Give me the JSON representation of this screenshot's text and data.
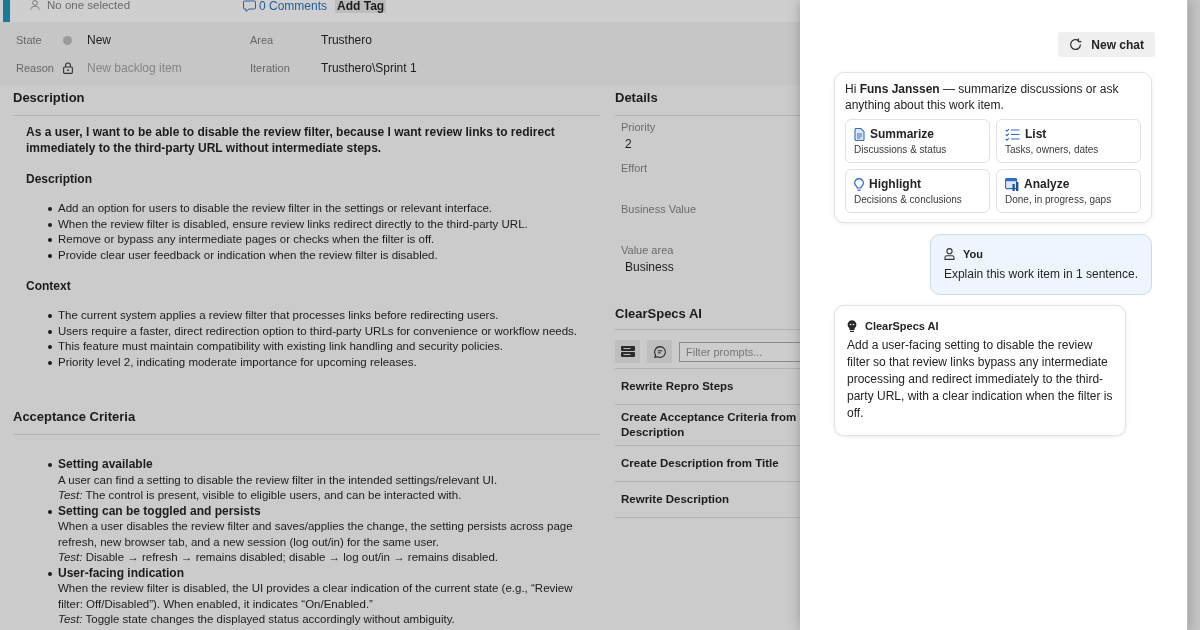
{
  "work_item_header": {
    "assignee": "No one selected",
    "comments_link": "0 Comments",
    "add_tag_button": "Add Tag"
  },
  "fields": [
    {
      "kind": "state",
      "label": "State",
      "value": "New",
      "color": "#9b9b9b"
    },
    {
      "kind": "text",
      "label": "Area",
      "value": "Trusthero"
    },
    {
      "kind": "locked",
      "label": "Reason",
      "value": "New backlog item"
    },
    {
      "kind": "text",
      "label": "Iteration",
      "value": "Trusthero\\Sprint 1"
    }
  ],
  "description": {
    "heading": "Description",
    "summary": "As a user, I want to be able to disable the review filter, because I want review links to redirect immediately to the third-party URL without intermediate steps.",
    "sections": [
      {
        "heading": "Description",
        "bullets": [
          "Add an option for users to disable the review filter in the settings or relevant interface.",
          "When the review filter is disabled, ensure review links redirect directly to the third-party URL.",
          "Remove or bypass any intermediate pages or checks when the filter is off.",
          "Provide clear user feedback or indication when the review filter is disabled."
        ]
      },
      {
        "heading": "Context",
        "bullets": [
          "The current system applies a review filter that processes links before redirecting users.",
          "Users require a faster, direct redirection option to third-party URLs for convenience or workflow needs.",
          "This feature must maintain compatibility with existing link handling and security policies.",
          "Priority level 2, indicating moderate importance for upcoming releases."
        ]
      }
    ]
  },
  "acceptance_criteria": {
    "heading": "Acceptance Criteria",
    "items": [
      {
        "title": "Setting available",
        "text": "A user can find a setting to disable the review filter in the intended settings/relevant UI.",
        "test": "*Test:* The control is present, visible to eligible users, and can be interacted with."
      },
      {
        "title": "Setting can be toggled and persists",
        "text": "When a user disables the review filter and saves/applies the change, the setting persists across page refresh, new browser tab, and a new session (log out/in) for the same user.",
        "test": "*Test:* Disable → refresh → remains disabled; disable → log out/in → remains disabled."
      },
      {
        "title": "User-facing indication",
        "text": "When the review filter is disabled, the UI provides a clear indication of the current state (e.g., “Review filter: Off/Disabled”). When enabled, it indicates “On/Enabled.”",
        "test": "*Test:* Toggle state changes the displayed status accordingly without ambiguity."
      }
    ]
  },
  "details": {
    "heading": "Details",
    "fields": [
      {
        "label": "Priority",
        "value": "2"
      },
      {
        "label": "Effort"
      },
      {
        "label": "Business Value"
      },
      {
        "label": "Value area",
        "value": "Business"
      }
    ]
  },
  "clearspecs": {
    "heading": "ClearSpecs AI",
    "filter": {
      "placeholder": "Filter prompts..."
    },
    "prompts": [
      "Rewrite Repro Steps",
      "Create Acceptance Criteria from Description",
      "Create Description from Title",
      "Rewrite Description"
    ]
  },
  "chat_panel": {
    "new_chat_button": "New chat",
    "greeting": "Hi **Funs Janssen** — summarize discussions or ask anything about this work item.",
    "actions": [
      {
        "title": "Summarize",
        "subtitle": "Discussions & status"
      },
      {
        "title": "List",
        "subtitle": "Tasks, owners, dates"
      },
      {
        "title": "Highlight",
        "subtitle": "Decisions & conclusions"
      },
      {
        "title": "Analyze",
        "subtitle": "Done, in progress, gaps"
      }
    ],
    "messages": [
      {
        "kind": "user",
        "author": "You",
        "text": "Explain this work item in 1 sentence."
      },
      {
        "kind": "assistant",
        "author": "ClearSpecs AI",
        "text": "Add a user-facing setting to disable the review filter so that review links bypass any intermediate processing and redirect immediately to the third-party URL, with a clear indication when the filter is off."
      }
    ]
  }
}
